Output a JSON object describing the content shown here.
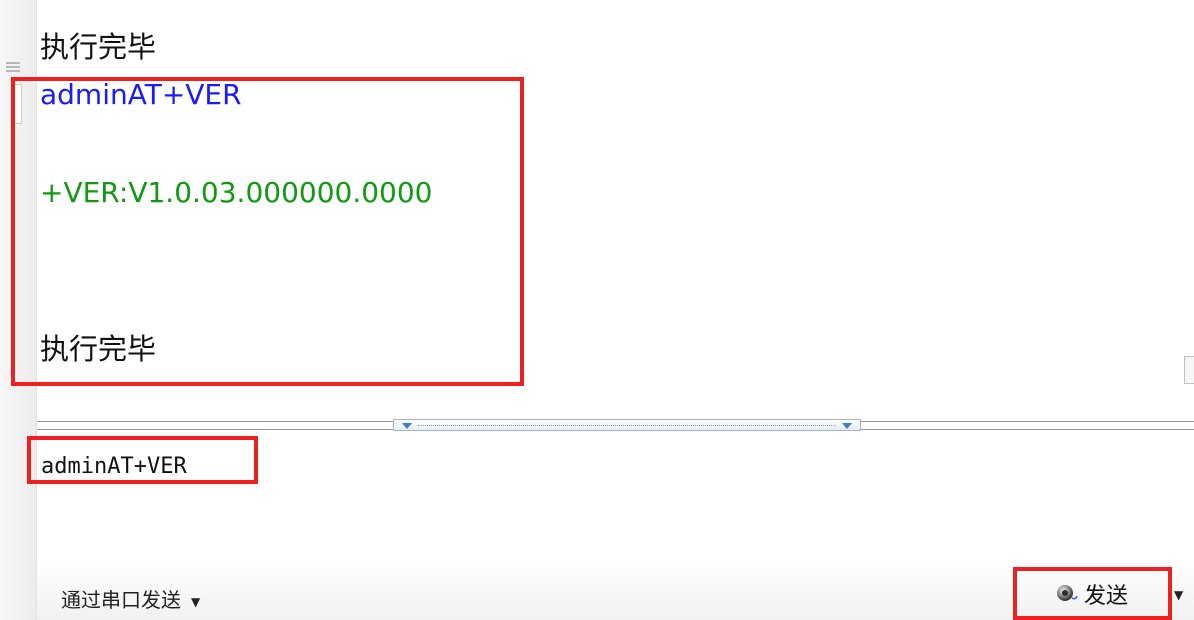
{
  "log": {
    "lines": [
      {
        "text": "执行完毕",
        "kind": "status"
      },
      {
        "text": "adminAT+VER",
        "kind": "sent"
      },
      {
        "text": "+VER:V1.0.03.000000.0000",
        "kind": "reply"
      },
      {
        "text": "执行完毕",
        "kind": "status"
      }
    ]
  },
  "input": {
    "value": "adminAT+VER",
    "placeholder": ""
  },
  "toolbar": {
    "send_mode": "通过串口发送",
    "send_mode_caret": "▼",
    "send_label": "发送",
    "send_dropdown": "▼"
  },
  "colors": {
    "sent_text": "#1a1aff",
    "reply_text": "#119911",
    "highlight": "#ee2020"
  },
  "icons": {
    "send": "speaker-send-icon"
  }
}
